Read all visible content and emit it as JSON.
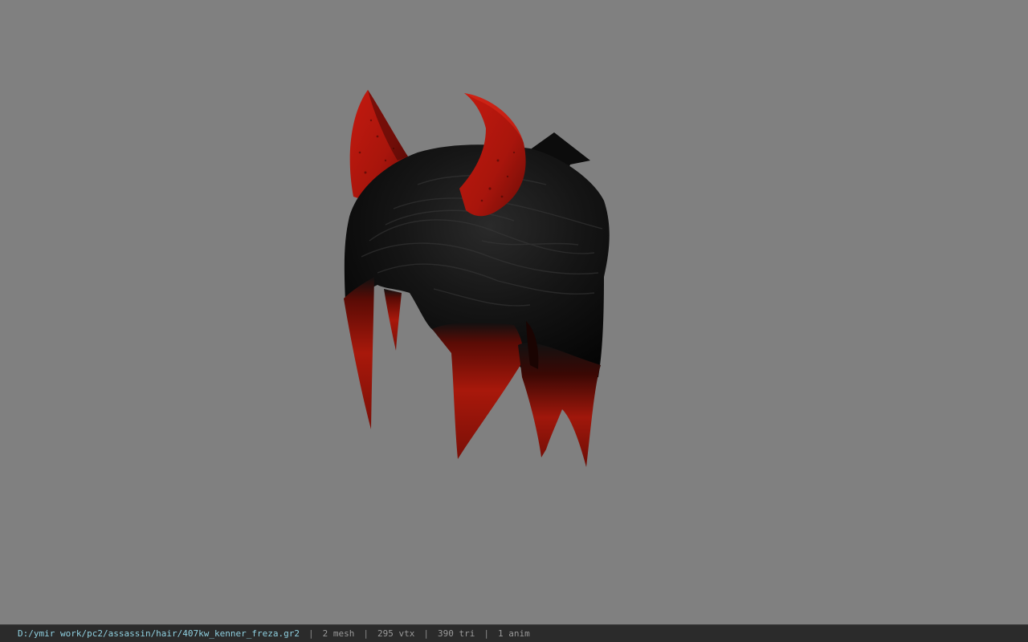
{
  "viewer": {
    "background_color": "#808080",
    "model": {
      "name": "devil-horn-hair-model",
      "hair_color": "#101010",
      "tip_color": "#b01a0c",
      "horn_color": "#b5160d"
    }
  },
  "status_bar": {
    "file_path": "D:/ymir work/pc2/assassin/hair/407kw_kenner_freza.gr2",
    "separator": "|",
    "mesh_count": "2 mesh",
    "vertex_count": "295 vtx",
    "triangle_count": "390 tri",
    "anim_count": "1 anim"
  }
}
